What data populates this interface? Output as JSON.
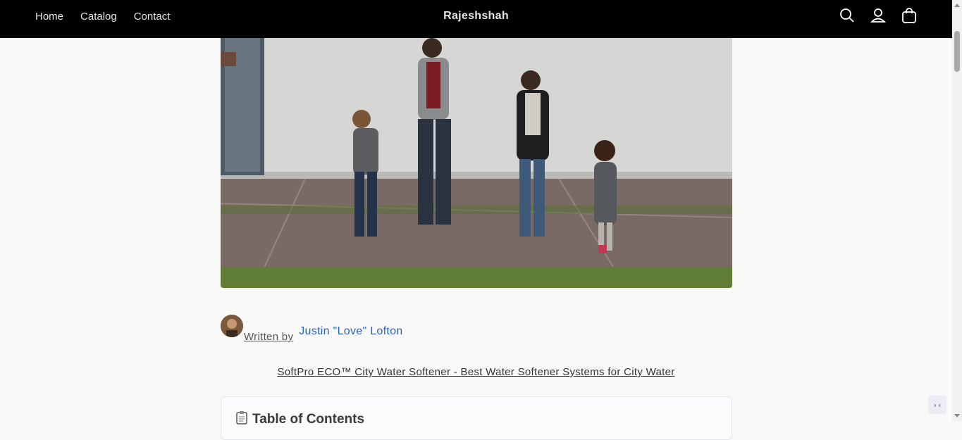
{
  "header": {
    "nav": [
      "Home",
      "Catalog",
      "Contact"
    ],
    "brand": "Rajeshshah",
    "icons": [
      "search-icon",
      "account-icon",
      "cart-icon"
    ]
  },
  "article": {
    "written_by_label": "Written by",
    "author": "Justin \"Love\" Lofton",
    "product_link": "SoftPro ECO™ City Water Softener - Best Water Softener Systems for City Water",
    "toc_title": "Table of Contents",
    "toc_icon": "clipboard-icon"
  },
  "widget": {
    "label": "›‹",
    "icon": "chat-widget-icon"
  },
  "colors": {
    "header_bg": "#000000",
    "page_bg": "#f9f9f7",
    "link": "#2a63c8"
  }
}
